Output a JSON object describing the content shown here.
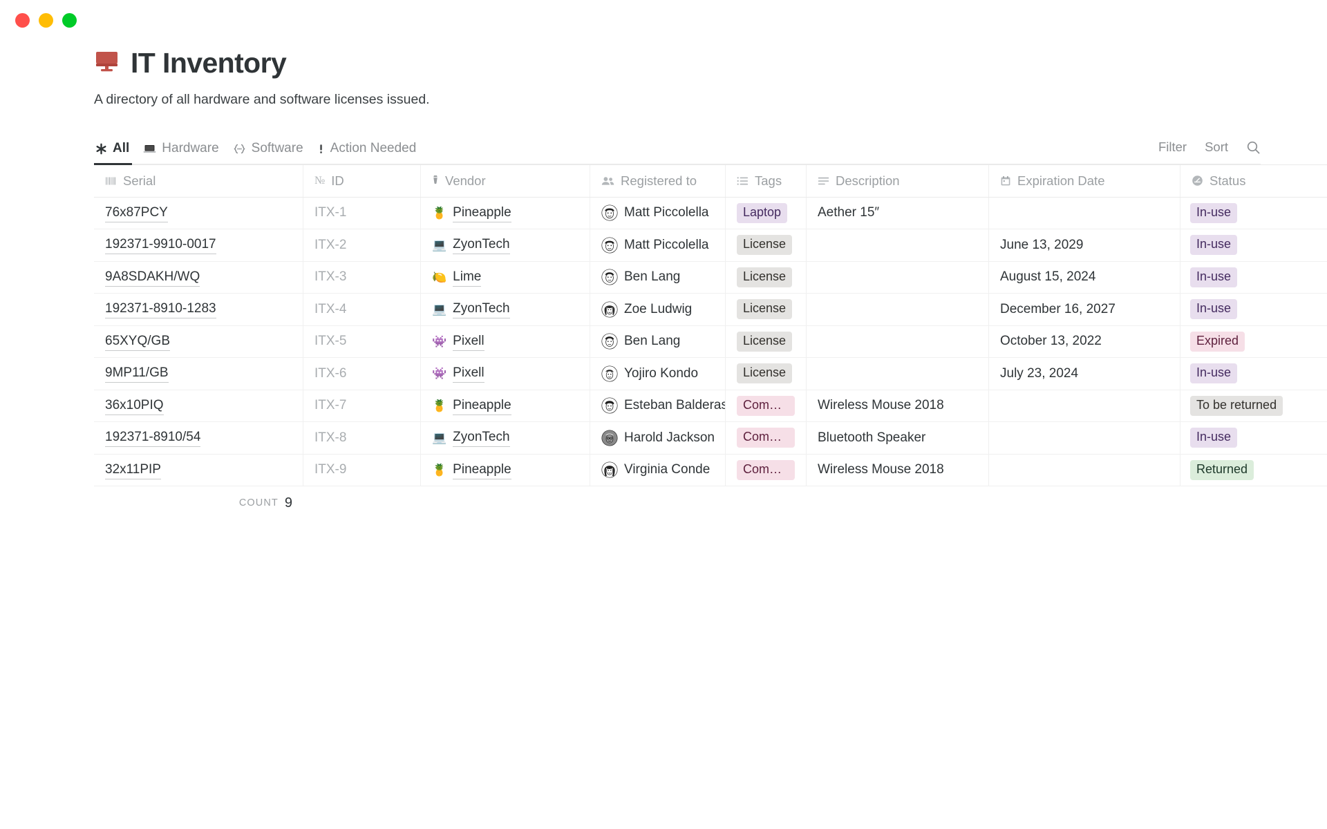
{
  "window": {
    "lights": [
      "close",
      "minimize",
      "maximize"
    ]
  },
  "header": {
    "emoji": "🖥️",
    "title": "IT Inventory",
    "description": "A directory of all hardware and software licenses issued."
  },
  "tabs": [
    {
      "label": "All",
      "icon": "asterisk-icon",
      "glyph": "✳",
      "active": true
    },
    {
      "label": "Hardware",
      "icon": "laptop-icon",
      "glyph": "💻",
      "active": false
    },
    {
      "label": "Software",
      "icon": "code-icon",
      "glyph": "{·}",
      "active": false
    },
    {
      "label": "Action Needed",
      "icon": "exclamation-icon",
      "glyph": "❗",
      "active": false
    }
  ],
  "toolbar": {
    "filter_label": "Filter",
    "sort_label": "Sort",
    "search_icon": "search-icon"
  },
  "table": {
    "columns": [
      {
        "label": "Serial",
        "icon": "barcode-icon"
      },
      {
        "label": "ID",
        "icon": "number-icon"
      },
      {
        "label": "Vendor",
        "icon": "necktie-icon"
      },
      {
        "label": "Registered to",
        "icon": "people-icon"
      },
      {
        "label": "Tags",
        "icon": "list-icon"
      },
      {
        "label": "Description",
        "icon": "text-lines-icon"
      },
      {
        "label": "Expiration Date",
        "icon": "calendar-icon"
      },
      {
        "label": "Status",
        "icon": "gauge-icon"
      }
    ],
    "rows": [
      {
        "serial": "76x87PCY",
        "id": "ITX-1",
        "vendor": "Pineapple",
        "vendor_emoji": "🍍",
        "person": "Matt Piccolella",
        "avatar": "face-matt",
        "tag": "Laptop",
        "tag_color": "purple",
        "description": "Aether 15″",
        "expiration": "",
        "status": "In-use",
        "status_color": "purple"
      },
      {
        "serial": "192371-9910-0017",
        "id": "ITX-2",
        "vendor": "ZyonTech",
        "vendor_emoji": "💻",
        "person": "Matt Piccolella",
        "avatar": "face-matt",
        "tag": "License",
        "tag_color": "gray",
        "description": "",
        "expiration": "June 13, 2029",
        "status": "In-use",
        "status_color": "purple"
      },
      {
        "serial": "9A8SDAKH/WQ",
        "id": "ITX-3",
        "vendor": "Lime",
        "vendor_emoji": "🍋",
        "person": "Ben Lang",
        "avatar": "face-ben",
        "tag": "License",
        "tag_color": "gray",
        "description": "",
        "expiration": "August 15, 2024",
        "status": "In-use",
        "status_color": "purple"
      },
      {
        "serial": "192371-8910-1283",
        "id": "ITX-4",
        "vendor": "ZyonTech",
        "vendor_emoji": "💻",
        "person": "Zoe Ludwig",
        "avatar": "face-zoe",
        "tag": "License",
        "tag_color": "gray",
        "description": "",
        "expiration": "December 16, 2027",
        "status": "In-use",
        "status_color": "purple"
      },
      {
        "serial": "65XYQ/GB",
        "id": "ITX-5",
        "vendor": "Pixell",
        "vendor_emoji": "👾",
        "person": "Ben Lang",
        "avatar": "face-ben",
        "tag": "License",
        "tag_color": "gray",
        "description": "",
        "expiration": "October 13, 2022",
        "status": "Expired",
        "status_color": "pink"
      },
      {
        "serial": "9MP11/GB",
        "id": "ITX-6",
        "vendor": "Pixell",
        "vendor_emoji": "👾",
        "person": "Yojiro Kondo",
        "avatar": "face-yojiro",
        "tag": "License",
        "tag_color": "gray",
        "description": "",
        "expiration": "July 23, 2024",
        "status": "In-use",
        "status_color": "purple"
      },
      {
        "serial": "36x10PIQ",
        "id": "ITX-7",
        "vendor": "Pineapple",
        "vendor_emoji": "🍍",
        "person": "Esteban Balderas",
        "avatar": "face-esteban",
        "tag": "Computer…",
        "tag_color": "pink",
        "description": "Wireless Mouse 2018",
        "expiration": "",
        "status": "To be returned",
        "status_color": "gray"
      },
      {
        "serial": "192371-8910/54",
        "id": "ITX-8",
        "vendor": "ZyonTech",
        "vendor_emoji": "💻",
        "person": "Harold Jackson",
        "avatar": "face-harold",
        "tag": "Computer…",
        "tag_color": "pink",
        "description": "Bluetooth Speaker",
        "expiration": "",
        "status": "In-use",
        "status_color": "purple"
      },
      {
        "serial": "32x11PIP",
        "id": "ITX-9",
        "vendor": "Pineapple",
        "vendor_emoji": "🍍",
        "person": "Virginia Conde",
        "avatar": "face-virginia",
        "tag": "Computer…",
        "tag_color": "pink",
        "description": "Wireless Mouse 2018",
        "expiration": "",
        "status": "Returned",
        "status_color": "green"
      }
    ]
  },
  "footer": {
    "count_label": "Count",
    "count_value": "9"
  },
  "colors": {
    "accent_red": "#c1534a",
    "text": "#2f3437",
    "muted": "#9b9fa2",
    "pill_purple_bg": "#e8deee",
    "pill_pink_bg": "#f6dfe7",
    "pill_green_bg": "#dbeddb",
    "pill_gray_bg": "#e4e3e1"
  }
}
